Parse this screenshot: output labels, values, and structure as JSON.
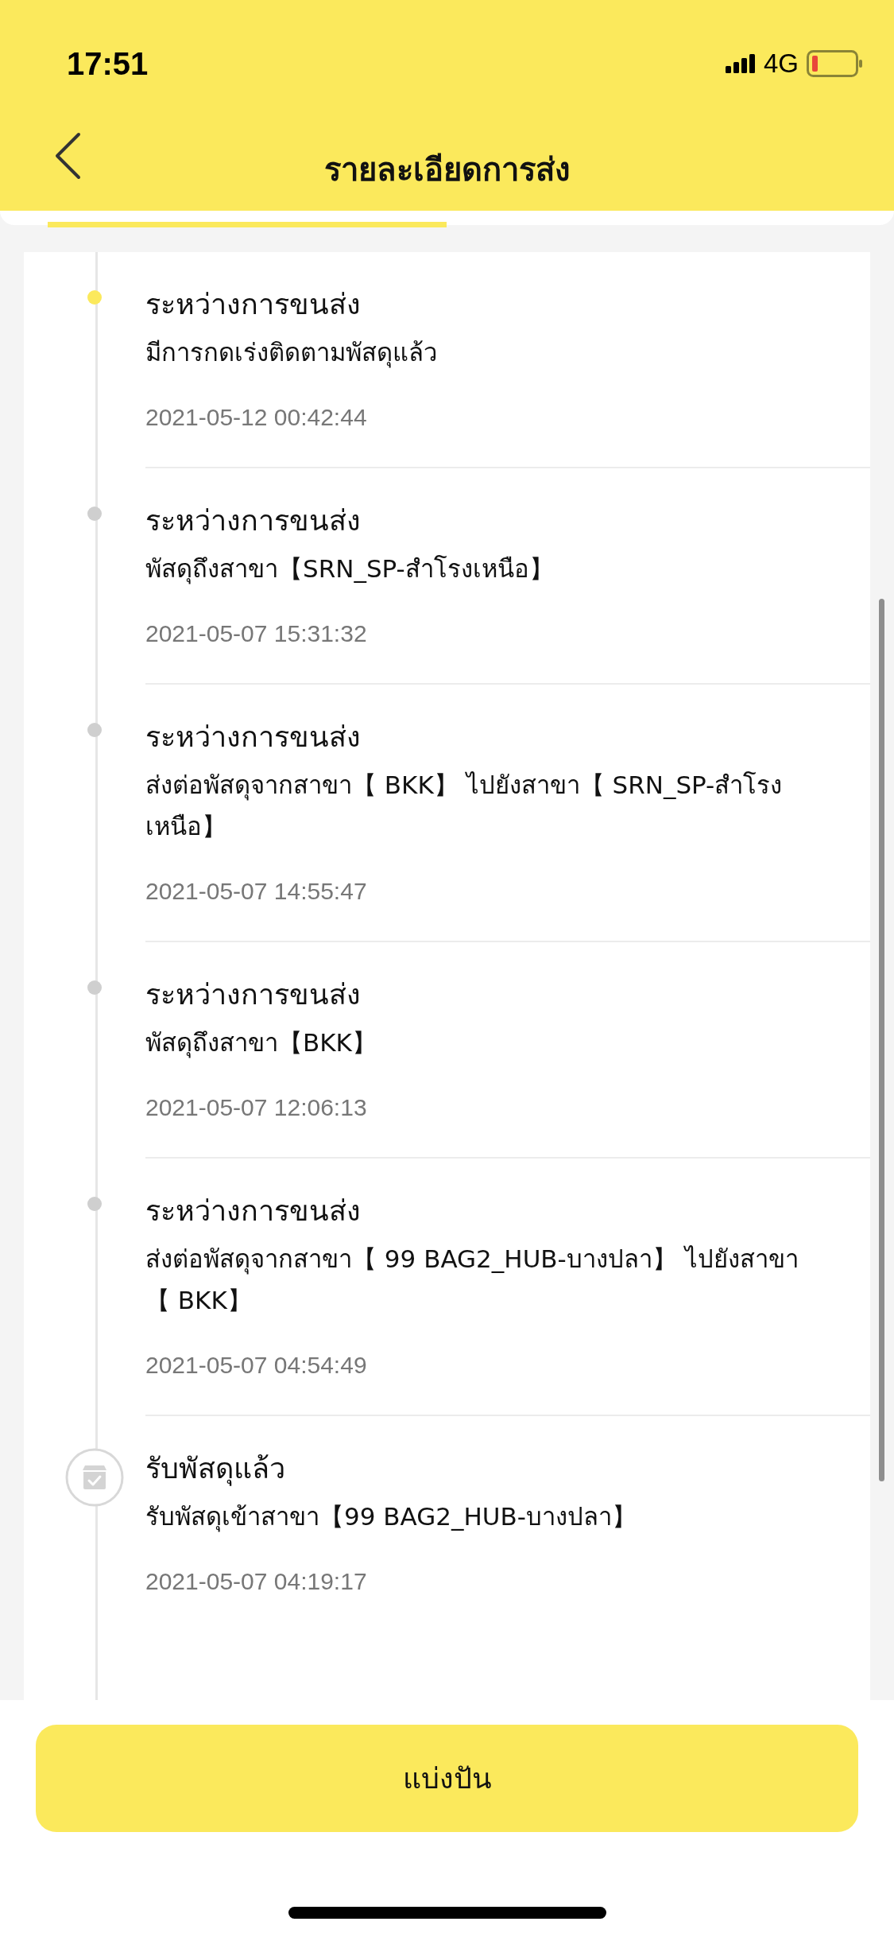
{
  "status_bar": {
    "time": "17:51",
    "network": "4G"
  },
  "header": {
    "title": "รายละเอียดการส่ง"
  },
  "events": [
    {
      "kind": "dot",
      "current": true,
      "title": "ระหว่างการขนส่ง",
      "description": "มีการกดเร่งติดตามพัสดุแล้ว",
      "time": "2021-05-12 00:42:44"
    },
    {
      "kind": "dot",
      "current": false,
      "title": "ระหว่างการขนส่ง",
      "description": "พัสดุถึงสาขา【SRN_SP-สำโรงเหนือ】",
      "time": "2021-05-07 15:31:32"
    },
    {
      "kind": "dot",
      "current": false,
      "title": "ระหว่างการขนส่ง",
      "description": "ส่งต่อพัสดุจากสาขา【 BKK】 ไปยังสาขา【 SRN_SP-สำโรงเหนือ】",
      "time": "2021-05-07 14:55:47"
    },
    {
      "kind": "dot",
      "current": false,
      "title": "ระหว่างการขนส่ง",
      "description": "พัสดุถึงสาขา【BKK】",
      "time": "2021-05-07 12:06:13"
    },
    {
      "kind": "dot",
      "current": false,
      "title": "ระหว่างการขนส่ง",
      "description": "ส่งต่อพัสดุจากสาขา【 99 BAG2_HUB-บางปลา】 ไปยังสาขา【 BKK】",
      "time": "2021-05-07 04:54:49"
    },
    {
      "kind": "package",
      "current": false,
      "title": "รับพัสดุแล้ว",
      "description": "รับพัสดุเข้าสาขา【99 BAG2_HUB-บางปลา】",
      "time": "2021-05-07 04:19:17"
    }
  ],
  "footer": {
    "button": "แบ่งปัน"
  }
}
